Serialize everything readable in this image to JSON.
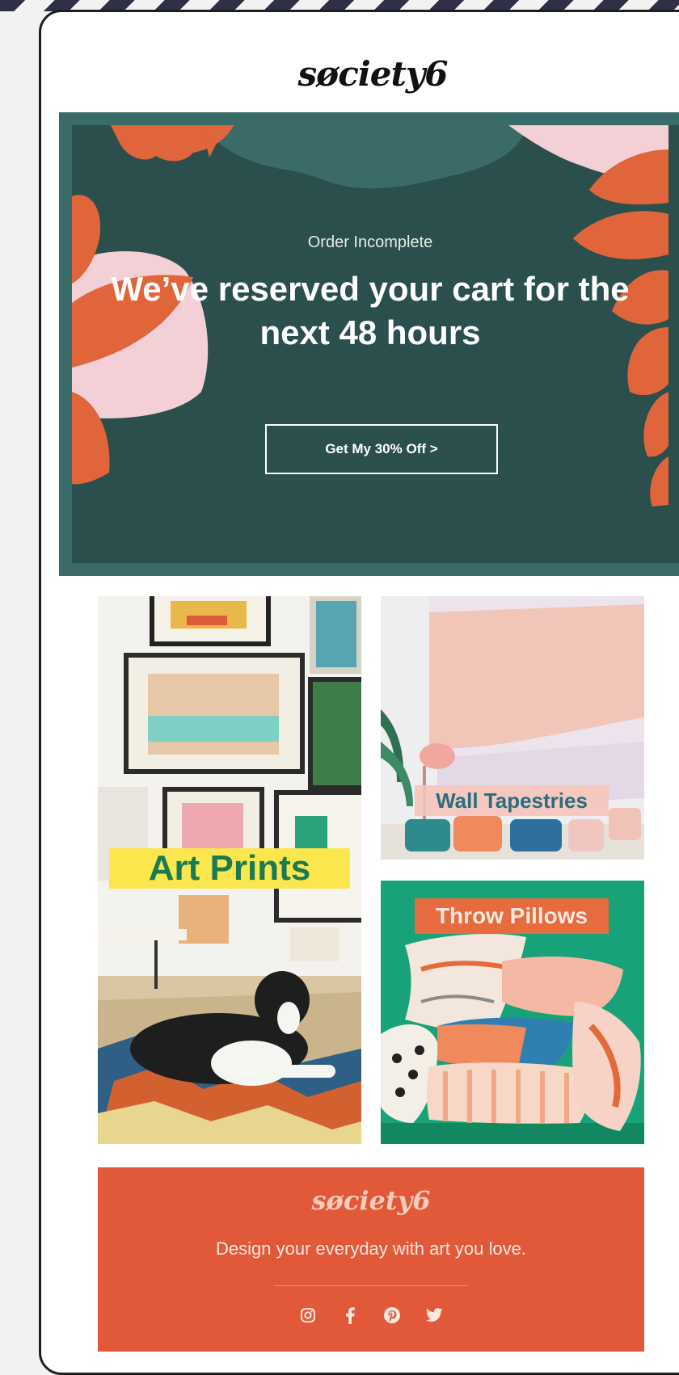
{
  "brand": {
    "logo_text": "søciety6"
  },
  "hero": {
    "eyebrow": "Order Incomplete",
    "headline": "We’ve reserved your cart for the next 48 hours",
    "cta_label": "Get My 30% Off  >"
  },
  "categories": [
    {
      "label": "Art Prints"
    },
    {
      "label": "Wall Tapestries"
    },
    {
      "label": "Throw Pillows"
    }
  ],
  "footer": {
    "logo_text": "søciety6",
    "tagline": "Design your everyday with art you love.",
    "social": [
      "instagram-icon",
      "facebook-icon",
      "pinterest-icon",
      "twitter-icon"
    ]
  },
  "colors": {
    "hero_bg": "#2a4f4d",
    "hero_border": "#3b6b68",
    "accent_orange": "#e2593a",
    "pink": "#f3cfd6",
    "art_label_bg": "#fbe74d",
    "art_label_text": "#1a7a52"
  }
}
